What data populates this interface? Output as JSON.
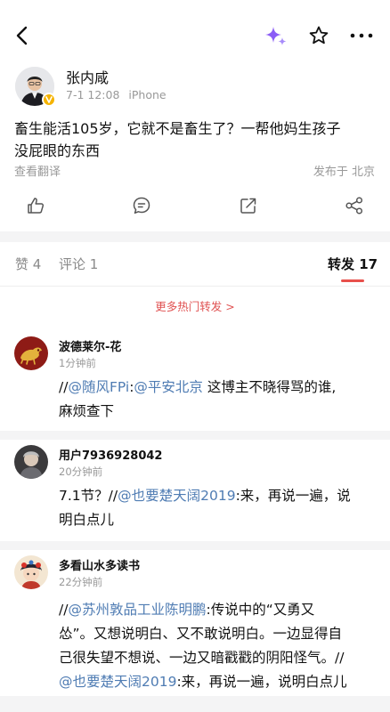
{
  "header": {
    "back_icon": "chevron-left-icon",
    "ai_icon": "sparkle-icon",
    "favorite_icon": "star-outline-icon",
    "more_icon": "more-horizontal-icon"
  },
  "post": {
    "author": "张内咸",
    "date": "7-1 12:08",
    "device": "iPhone",
    "text_line1": "畜生能活105岁，它就不是畜生了？一帮他妈生孩子",
    "text_line2": "没屁眼的东西",
    "translate_label": "查看翻译",
    "location_label": "发布于 北京"
  },
  "actions": {
    "like_icon": "thumb-up-icon",
    "comment_icon": "comment-icon",
    "repost_icon": "share-arrow-icon",
    "share_icon": "share-nodes-icon"
  },
  "tabs": {
    "likes": "赞 4",
    "comments": "评论 1",
    "reposts": "转发 17"
  },
  "more_hot_reposts": "更多热门转发 >",
  "reposts": [
    {
      "name": "波德莱尔-花",
      "time": "1分钟前",
      "l1_pre": "//",
      "l1_m1": "@随风FPi",
      "l1_colon": ":",
      "l1_m2": "@平安北京",
      "l1_rest": " 这博主不晓得骂的谁,",
      "l2": "麻烦查下"
    },
    {
      "name": "用户7936928042",
      "time": "20分钟前",
      "l1_pre": "7.1节？//",
      "l1_m1": "@也要楚天阔2019",
      "l1_rest": ":来，再说一遍，说",
      "l2": "明白点儿"
    },
    {
      "name": "多看山水多读书",
      "time": "22分钟前",
      "l1_pre": "//",
      "l1_m1": "@苏州敦品工业陈明鹏",
      "l1_rest": ":传说中的“又勇又",
      "l2": "怂”。又想说明白、又不敢说明白。一边显得自",
      "l3": "己很失望不想说、一边又暗戳戳的阴阳怪气。//",
      "l4_m1": "@也要楚天阔2019",
      "l4_rest": ":来，再说一遍，说明白点儿"
    }
  ]
}
